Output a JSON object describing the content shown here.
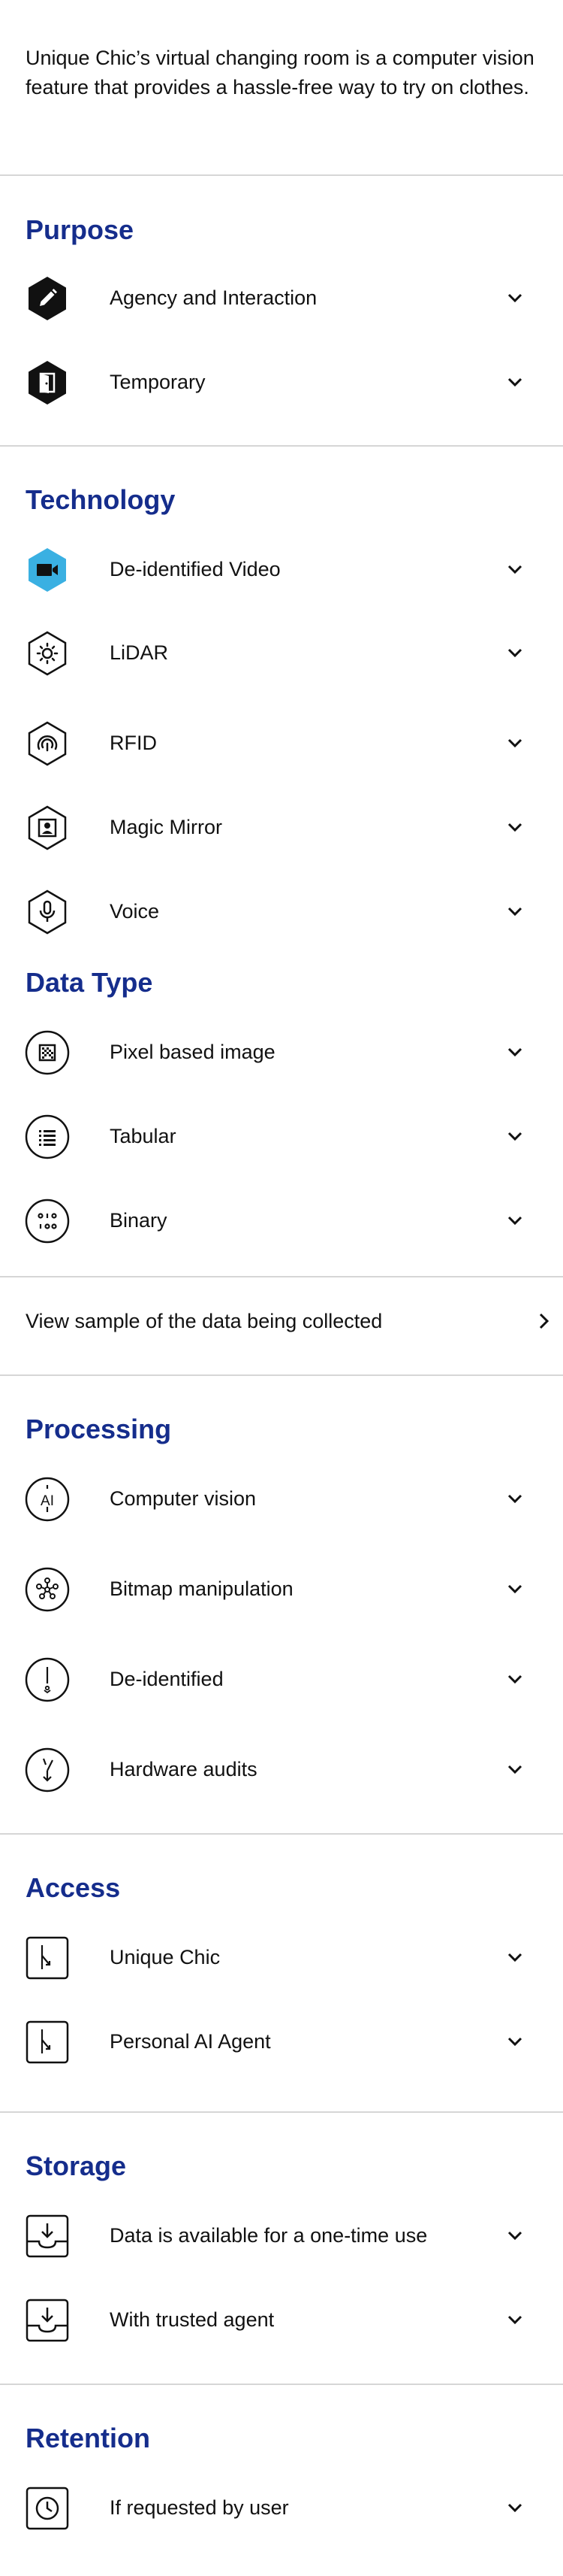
{
  "intro": "Unique Chic’s virtual changing room is a computer vision feature that provides a hassle-free way to try on clothes.",
  "sections": {
    "purpose": {
      "title": "Purpose",
      "items": [
        {
          "label": "Agency and Interaction",
          "icon": "pencil-icon"
        },
        {
          "label": "Temporary",
          "icon": "door-exit-icon"
        }
      ]
    },
    "technology": {
      "title": "Technology",
      "items": [
        {
          "label": "De-identified Video",
          "icon": "video-camera-icon"
        },
        {
          "label": "LiDAR",
          "icon": "lidar-sun-icon"
        },
        {
          "label": "RFID",
          "icon": "rfid-signal-icon"
        },
        {
          "label": "Magic Mirror",
          "icon": "mirror-person-icon"
        },
        {
          "label": "Voice",
          "icon": "microphone-icon"
        }
      ]
    },
    "data_type": {
      "title": "Data Type",
      "items": [
        {
          "label": "Pixel based image",
          "icon": "pixel-image-icon"
        },
        {
          "label": "Tabular",
          "icon": "list-table-icon"
        },
        {
          "label": "Binary",
          "icon": "binary-icon"
        }
      ],
      "link": "View sample of the data being collected"
    },
    "processing": {
      "title": "Processing",
      "items": [
        {
          "label": "Computer vision",
          "icon": "ai-icon"
        },
        {
          "label": "Bitmap manipulation",
          "icon": "bitmap-nodes-icon"
        },
        {
          "label": "De-identified",
          "icon": "de-identified-icon"
        },
        {
          "label": "Hardware audits",
          "icon": "hardware-audit-icon"
        }
      ]
    },
    "access": {
      "title": "Access",
      "items": [
        {
          "label": "Unique Chic",
          "icon": "access-branch-icon"
        },
        {
          "label": "Personal AI Agent",
          "icon": "access-branch-icon"
        }
      ]
    },
    "storage": {
      "title": "Storage",
      "items": [
        {
          "label": "Data is available for a one-time use",
          "icon": "inbox-download-icon"
        },
        {
          "label": "With trusted agent",
          "icon": "inbox-download-icon"
        }
      ]
    },
    "retention": {
      "title": "Retention",
      "items": [
        {
          "label": "If requested by user",
          "icon": "clock-icon"
        }
      ]
    }
  },
  "colors": {
    "heading": "#152d8c",
    "video_icon_fill": "#3ab0e2",
    "divider": "#d6d6d6",
    "text": "#111111"
  }
}
